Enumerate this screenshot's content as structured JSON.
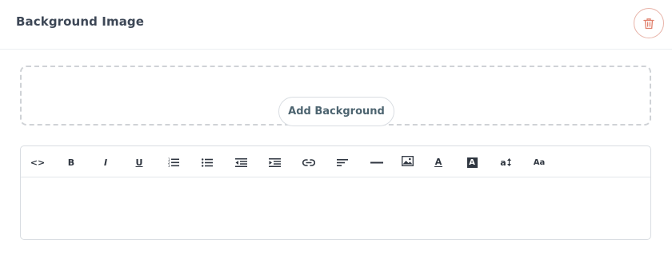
{
  "header": {
    "title": "Background Image",
    "delete_icon": "trash-icon",
    "delete_color": "#e0806c"
  },
  "dropzone": {
    "add_button_label": "Add Background"
  },
  "toolbar": {
    "code": {
      "label": "<>",
      "icon": "code-icon"
    },
    "bold": {
      "label": "B",
      "icon": "bold-icon"
    },
    "italic": {
      "label": "I",
      "icon": "italic-icon"
    },
    "underline": {
      "label": "U",
      "icon": "underline-icon"
    },
    "ordered_list": {
      "icon": "ordered-list-icon"
    },
    "unordered_list": {
      "icon": "unordered-list-icon"
    },
    "outdent": {
      "icon": "outdent-icon"
    },
    "indent": {
      "icon": "indent-icon"
    },
    "link": {
      "icon": "link-icon"
    },
    "align": {
      "icon": "align-left-icon"
    },
    "horizontal_rule": {
      "icon": "horizontal-rule-icon"
    },
    "image": {
      "icon": "image-icon"
    },
    "font_color": {
      "label": "A",
      "icon": "font-color-icon"
    },
    "background_color": {
      "label": "A",
      "icon": "background-color-icon"
    },
    "font_size": {
      "label": "a",
      "icon": "font-size-icon"
    },
    "font_family": {
      "label": "Aa",
      "icon": "font-family-icon"
    }
  },
  "editor": {
    "content": ""
  }
}
